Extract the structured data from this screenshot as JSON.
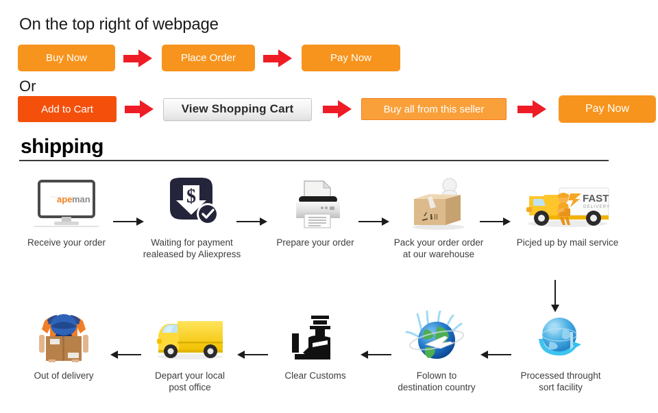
{
  "top": {
    "heading": "On the top right of webpage",
    "or_label": "Or",
    "row1": {
      "buy_now": "Buy Now",
      "place_order": "Place Order",
      "pay_now": "Pay Now"
    },
    "row2": {
      "add_to_cart": "Add to Cart",
      "view_shopping_cart": "View Shopping Cart",
      "buy_all_from_seller": "Buy all from this seller",
      "pay_now": "Pay Now"
    },
    "colors": {
      "orange": "#F7941D",
      "orange_light": "#F9A03A",
      "orange_deep": "#F4500C",
      "arrow_red": "#EE1C25",
      "gray_button_border": "#c6c6c6"
    }
  },
  "shipping": {
    "title": "shipping"
  },
  "steps": {
    "row1": [
      {
        "label": "Receive your order",
        "icon": "monitor-apeman-icon",
        "brand": {
          "part1": "ape",
          "part2": "man"
        }
      },
      {
        "label": "Waiting for payment\nrealeased by Aliexpress",
        "icon": "payment-dollar-check-icon"
      },
      {
        "label": "Prepare your order",
        "icon": "printer-icon"
      },
      {
        "label": "Pack your order order\nat our warehouse",
        "icon": "packing-box-person-icon"
      },
      {
        "label": "Picjed up by mail service",
        "icon": "fast-delivery-truck-icon",
        "truck_text": {
          "line1": "FAST",
          "line2": "DELIVERY"
        }
      }
    ],
    "row2": [
      {
        "label": "Out of delivery",
        "icon": "courier-carrying-box-icon"
      },
      {
        "label": "Depart your local\npost office",
        "icon": "yellow-van-icon"
      },
      {
        "label": "Clear Customs",
        "icon": "customs-officer-icon"
      },
      {
        "label": "Folown to\ndestination country",
        "icon": "globe-airplane-icon"
      },
      {
        "label": "Processed throught\nsort facility",
        "icon": "globe-swoosh-icon"
      }
    ]
  }
}
